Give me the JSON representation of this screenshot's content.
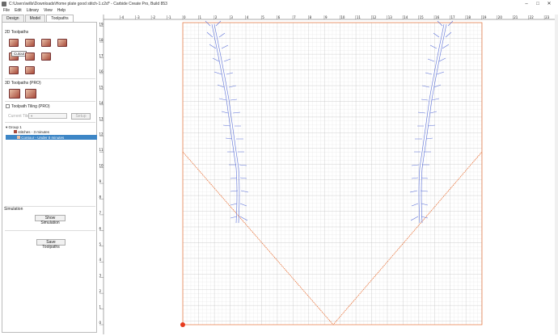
{
  "window": {
    "title": "C:\\Users\\wills\\Downloads\\Home plate good stitch-1.c2d* - Carbide Create Pro, Build 853"
  },
  "menu": [
    "File",
    "Edit",
    "Library",
    "View",
    "Help"
  ],
  "tabs": [
    "Design",
    "Model",
    "Toolpaths"
  ],
  "left": {
    "section_2d": "2D Toolpaths",
    "tooltip": "Cutout",
    "section_3d": "3D Toolpaths (PRO)",
    "tiling_label": "Toolpath Tiling (PRO)",
    "current_tile_label": "Current Tile",
    "setup_label": "Setup",
    "group_label": "Group 1",
    "stitches_label": "stitches - 3 minutes",
    "contour_label": "Contour - Under 0 minutes",
    "simulation_label": "Simulation",
    "show_simulation": "Show Simulation",
    "save_toolpaths": "Save Toolpaths"
  },
  "ruler": {
    "h_labels": [
      "-4",
      "-3",
      "-2",
      "-1",
      "0",
      "1",
      "2",
      "3",
      "4",
      "5",
      "6",
      "7",
      "8",
      "9",
      "10",
      "11",
      "12",
      "13",
      "14",
      "15",
      "16",
      "17",
      "18",
      "19",
      "20",
      "21",
      "22",
      "23"
    ],
    "v_labels": [
      "19",
      "18",
      "17",
      "16",
      "15",
      "14",
      "13",
      "12",
      "11",
      "10",
      "9",
      "8",
      "7",
      "6",
      "5",
      "4",
      "3",
      "2",
      "1",
      "0"
    ]
  },
  "colors": {
    "selection": "#3d86c6",
    "outline": "#e8733a",
    "stitch": "#5a6fd8",
    "grid": "#d4d4d4"
  }
}
